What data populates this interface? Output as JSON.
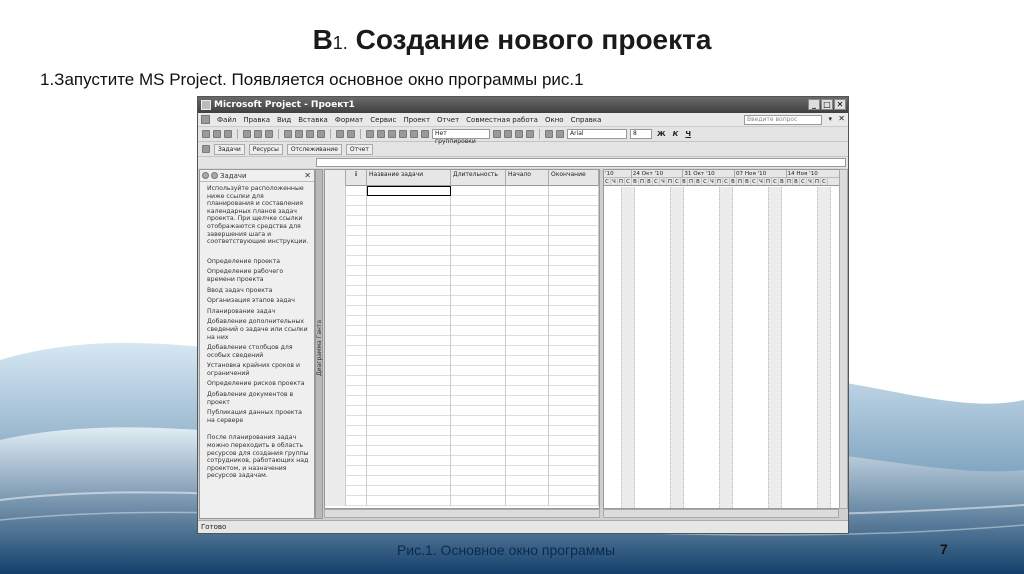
{
  "slide": {
    "title_main": "В",
    "title_sub": "1.",
    "title_rest": " Создание нового проекта",
    "subtitle": "1.Запустите MS Project. Появляется основное окно программы рис.1",
    "caption": "Рис.1. Основное окно программы",
    "page_number": "7"
  },
  "window": {
    "title": "Microsoft Project - Проект1",
    "min": "_",
    "max": "□",
    "close": "✕"
  },
  "menu": {
    "items": [
      "Файл",
      "Правка",
      "Вид",
      "Вставка",
      "Формат",
      "Сервис",
      "Проект",
      "Отчет",
      "Совместная работа",
      "Окно",
      "Справка"
    ],
    "ask_placeholder": "Введите вопрос",
    "close_doc": "✕"
  },
  "toolbar": {
    "grouping": "Нет группировки",
    "font": "Arial",
    "size": "8",
    "bold": "Ж",
    "italic": "К",
    "underline": "Ч"
  },
  "toolbar2": {
    "items": [
      "Задачи",
      "Ресурсы",
      "Отслеживание",
      "Отчет"
    ]
  },
  "taskpane": {
    "title": "Задачи",
    "close": "✕",
    "intro": "Используйте расположенные ниже ссылки для планирования и составления календарных планов задач проекта. При щелчке ссылки отображаются средства для завершения шага и соответствующие инструкции.",
    "links": [
      "Определение проекта",
      "Определение рабочего времени проекта",
      "Ввод задач проекта",
      "Организация этапов задач",
      "Планирование задач",
      "Добавление дополнительных сведений о задаче или ссылки на них",
      "Добавление столбцов для особых сведений",
      "Установка крайних сроков и ограничений",
      "Определение рисков проекта",
      "Добавление документов в проект",
      "Публикация данных проекта на сервере"
    ],
    "outro": "После планирования задач можно переходить в область ресурсов для создания группы сотрудников, работающих над проектом, и назначения ресурсов задачам."
  },
  "vbar": {
    "label": "Диаграмма Ганта"
  },
  "grid": {
    "headers": {
      "info": "i",
      "name": "Название задачи",
      "duration": "Длительность",
      "start": "Начало",
      "end": "Окончание"
    }
  },
  "gantt": {
    "weeks": [
      "'10",
      "24 Окт '10",
      "31 Окт '10",
      "07 Ноя '10",
      "14 Ноя '10"
    ],
    "days": [
      "С",
      "Ч",
      "П",
      "С",
      "В",
      "П",
      "В",
      "С",
      "Ч",
      "П",
      "С",
      "В",
      "П",
      "В",
      "С",
      "Ч",
      "П",
      "С",
      "В",
      "П",
      "В",
      "С",
      "Ч",
      "П",
      "С",
      "В",
      "П",
      "В",
      "С",
      "Ч",
      "П",
      "С"
    ]
  },
  "status": {
    "text": "Готово"
  }
}
